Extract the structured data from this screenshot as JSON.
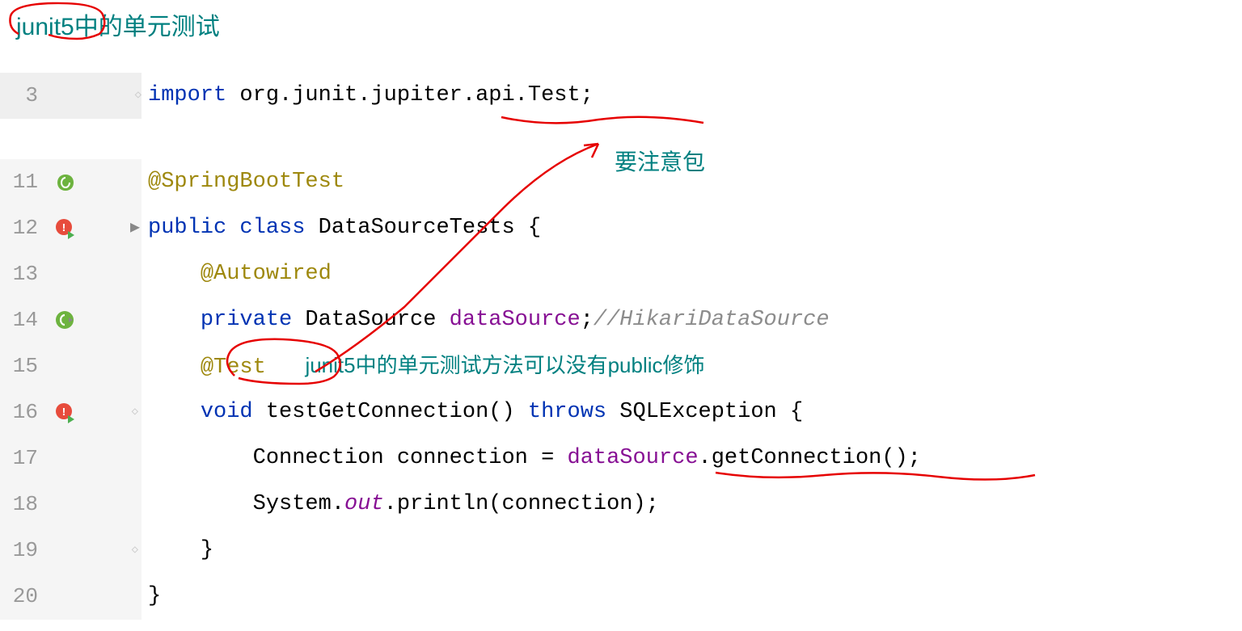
{
  "title_highlight": "junit5",
  "title_rest": "中的单元测试",
  "lines": {
    "l3": {
      "num": "3",
      "import_kw": "import",
      "pkg": " org.junit.jupiter.api.",
      "cls": "Test",
      "semi": ";"
    },
    "l11": {
      "num": "11",
      "annotation": "@SpringBootTest"
    },
    "l12": {
      "num": "12",
      "public": "public",
      "class_kw": " class",
      "name": " DataSourceTests ",
      "brace": "{"
    },
    "l13": {
      "num": "13",
      "annotation": "@Autowired"
    },
    "l14": {
      "num": "14",
      "private_kw": "private",
      "type": " DataSource ",
      "field": "dataSource",
      "semi": ";",
      "comment": "//HikariDataSource"
    },
    "l15": {
      "num": "15",
      "annotation": "@Test",
      "note": "junit5中的单元测试方法可以没有public修饰"
    },
    "l16": {
      "num": "16",
      "void_kw": "void",
      "method": " testGetConnection() ",
      "throws_kw": "throws",
      "exc": " SQLException ",
      "brace": "{"
    },
    "l17": {
      "num": "17",
      "pre": "Connection connection = ",
      "field": "dataSource",
      "post": ".getConnection();"
    },
    "l18": {
      "num": "18",
      "pre": "System.",
      "out": "out",
      "post": ".println(connection);"
    },
    "l19": {
      "num": "19",
      "brace": "}"
    },
    "l20": {
      "num": "20",
      "brace": "}"
    }
  },
  "annotations": {
    "note_package": "要注意包"
  }
}
